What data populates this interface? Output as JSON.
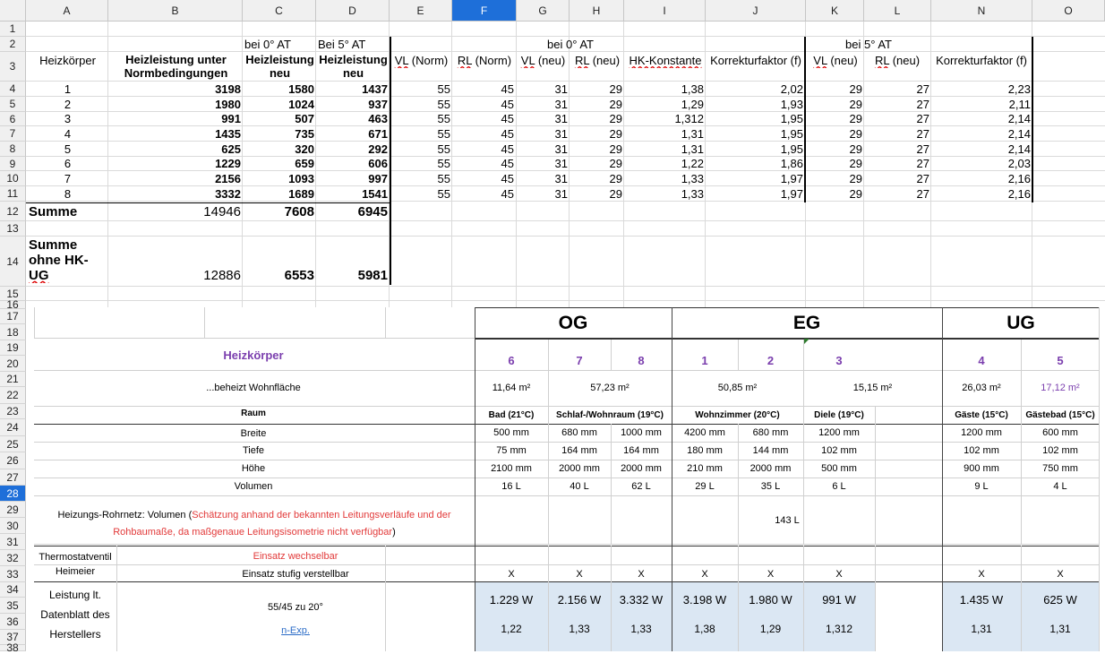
{
  "columns": [
    "A",
    "B",
    "C",
    "D",
    "E",
    "F",
    "G",
    "H",
    "I",
    "J",
    "K",
    "L",
    "N",
    "O"
  ],
  "selected_column": "F",
  "rows": [
    "1",
    "2",
    "3",
    "4",
    "5",
    "6",
    "7",
    "8",
    "9",
    "10",
    "11",
    "12",
    "13",
    "14",
    "15",
    "16",
    "17",
    "18",
    "19",
    "20",
    "21",
    "22",
    "23",
    "24",
    "25",
    "26",
    "27",
    "28",
    "29",
    "30",
    "31",
    "32",
    "33",
    "34",
    "35",
    "36",
    "37",
    "38"
  ],
  "selected_row": "28",
  "sheet": {
    "row2": {
      "c": "bei 0° AT",
      "d": "Bei 5° AT",
      "gh": "bei 0° AT",
      "kl": "bei 5° AT"
    },
    "row3": {
      "a": "Heizkörper",
      "b1": "Heizleistung unter",
      "b2": "Normbedingungen",
      "c1": "Heizleistung",
      "c2": "neu",
      "d1": "Heizleistung",
      "d2": "neu",
      "e_pre": "VL",
      "e_post": " (Norm)",
      "f_pre": "RL",
      "f_post": " (Norm)",
      "g_pre": "VL",
      "g_post": " (neu)",
      "h_pre": "RL",
      "h_post": " (neu)",
      "i": "HK-Konstante",
      "j": "Korrekturfaktor (f)",
      "k_pre": "VL",
      "k_post": " (neu)",
      "l_pre": "RL",
      "l_post": " (neu)",
      "n": "Korrekturfaktor (f)"
    },
    "data": [
      [
        "1",
        "3198",
        "1580",
        "1437",
        "55",
        "45",
        "31",
        "29",
        "1,38",
        "2,02",
        "29",
        "27",
        "2,23"
      ],
      [
        "2",
        "1980",
        "1024",
        "937",
        "55",
        "45",
        "31",
        "29",
        "1,29",
        "1,93",
        "29",
        "27",
        "2,11"
      ],
      [
        "3",
        "991",
        "507",
        "463",
        "55",
        "45",
        "31",
        "29",
        "1,312",
        "1,95",
        "29",
        "27",
        "2,14"
      ],
      [
        "4",
        "1435",
        "735",
        "671",
        "55",
        "45",
        "31",
        "29",
        "1,31",
        "1,95",
        "29",
        "27",
        "2,14"
      ],
      [
        "5",
        "625",
        "320",
        "292",
        "55",
        "45",
        "31",
        "29",
        "1,31",
        "1,95",
        "29",
        "27",
        "2,14"
      ],
      [
        "6",
        "1229",
        "659",
        "606",
        "55",
        "45",
        "31",
        "29",
        "1,22",
        "1,86",
        "29",
        "27",
        "2,03"
      ],
      [
        "7",
        "2156",
        "1093",
        "997",
        "55",
        "45",
        "31",
        "29",
        "1,33",
        "1,97",
        "29",
        "27",
        "2,16"
      ],
      [
        "8",
        "3332",
        "1689",
        "1541",
        "55",
        "45",
        "31",
        "29",
        "1,33",
        "1,97",
        "29",
        "27",
        "2,16"
      ]
    ],
    "sum": {
      "label": "Summe",
      "b": "14946",
      "c": "7608",
      "d": "6945"
    },
    "sum2": {
      "l1": "Summe",
      "l2": "ohne HK-",
      "l3": "UG",
      "b": "12886",
      "c": "6553",
      "d": "5981"
    }
  },
  "embedded": {
    "floors": [
      "OG",
      "EG",
      "UG"
    ],
    "heizkoerper_label": "Heizkörper",
    "hk_numbers": [
      "6",
      "7",
      "8",
      "1",
      "2",
      "3",
      "4",
      "5"
    ],
    "wohnflaeche_label": "...beheizt Wohnfläche",
    "areas": [
      "11,64 m²",
      "57,23 m²",
      "50,85 m²",
      "15,15 m²",
      "26,03 m²",
      "17,12 m²"
    ],
    "raum_label": "Raum",
    "rooms": [
      "Bad (21°C)",
      "Schlaf-/Wohnraum (19°C)",
      "Wohnzimmer (20°C)",
      "Diele (19°C)",
      "Gäste (15°C)",
      "Gästebad (15°C)"
    ],
    "dim_labels": [
      "Breite",
      "Tiefe",
      "Höhe",
      "Volumen"
    ],
    "breite": [
      "500 mm",
      "680 mm",
      "1000 mm",
      "4200 mm",
      "680 mm",
      "1200 mm",
      "1200 mm",
      "600 mm"
    ],
    "tiefe": [
      "75 mm",
      "164 mm",
      "164 mm",
      "180 mm",
      "144 mm",
      "102 mm",
      "102 mm",
      "102 mm"
    ],
    "hoehe": [
      "2100 mm",
      "2000 mm",
      "2000 mm",
      "210 mm",
      "2000 mm",
      "500 mm",
      "900 mm",
      "750 mm"
    ],
    "volumen": [
      "16 L",
      "40 L",
      "62 L",
      "29 L",
      "35 L",
      "6 L",
      "9 L",
      "4 L"
    ],
    "rohrnetz_a": "Heizungs-Rohrnetz: Volumen (",
    "rohrnetz_b": "Schätzung anhand der bekannten Leitungsverläufe und der",
    "rohrnetz_c": "Rohbaumaße, da maßgenaue Leitungsisometrie nicht verfügbar",
    "rohrnetz_d": ")",
    "rohrnetz_value": "143 L",
    "thermo_l1": "Thermostatventil",
    "thermo_l2": "Heimeier",
    "einsatz_wechsel": "Einsatz wechselbar",
    "einsatz_stufig": "Einsatz stufig verstellbar",
    "x_marks": [
      "X",
      "X",
      "X",
      "X",
      "X",
      "X",
      "X",
      "X"
    ],
    "leistung_l1": "Leistung lt.",
    "leistung_l2": "Datenblatt des",
    "leistung_l3": "Herstellers",
    "norm_label": "55/45 zu 20°",
    "nexp_label": "n-Exp.",
    "leistung": [
      "1.229 W",
      "2.156 W",
      "3.332 W",
      "3.198 W",
      "1.980 W",
      "991 W",
      "1.435 W",
      "625 W"
    ],
    "nexp": [
      "1,22",
      "1,33",
      "1,33",
      "1,38",
      "1,29",
      "1,312",
      "1,31",
      "1,31"
    ]
  },
  "colors": {
    "selection": "#1e6fd9",
    "header_bg": "#f0f0f0",
    "purple": "#7b3fae",
    "red": "#e23a3a",
    "blue_fill": "#dbe7f3"
  }
}
